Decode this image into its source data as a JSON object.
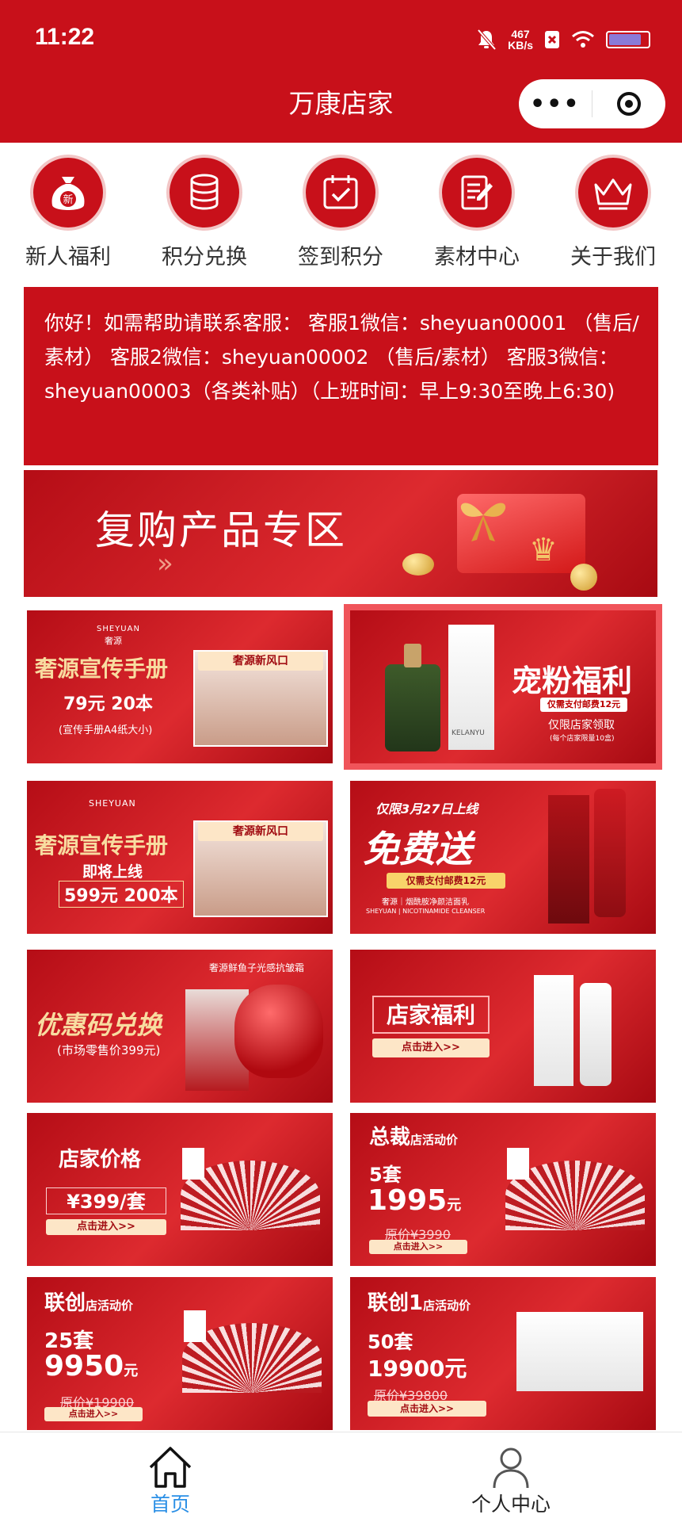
{
  "status_bar": {
    "time": "11:22",
    "net_speed": "467",
    "net_unit": "KB/s"
  },
  "header": {
    "title": "万康店家",
    "more_label": "•••"
  },
  "menu": [
    {
      "label": "新人福利",
      "icon": "money-bag-icon",
      "badge": "新"
    },
    {
      "label": "积分兑换",
      "icon": "coin-stack-icon"
    },
    {
      "label": "签到积分",
      "icon": "calendar-check-icon"
    },
    {
      "label": "素材中心",
      "icon": "document-edit-icon"
    },
    {
      "label": "关于我们",
      "icon": "crown-icon"
    }
  ],
  "notice": {
    "text": "你好！如需帮助请联系客服： 客服1微信：sheyuan00001 （售后/素材） 客服2微信：sheyuan00002 （售后/素材） 客服3微信：sheyuan00003（各类补贴）（上班时间：早上9:30至晚上6:30)"
  },
  "banners": {
    "repurchase": {
      "title": "复购产品专区",
      "arrows": "»"
    },
    "brochure1": {
      "brand": "SHEYUAN",
      "brand_cn": "奢源",
      "title": "奢源宣传手册",
      "price": "79元 20本",
      "note": "(宣传手册A4纸大小)",
      "tag": "奢源新风口"
    },
    "fan_benefit": {
      "title": "宠粉福利",
      "sub1": "仅需支付邮费12元",
      "sub2": "仅限店家领取",
      "sub3": "(每个店家限量10盒)",
      "product_brand": "KELANYU"
    },
    "brochure2": {
      "brand": "SHEYUAN",
      "title": "奢源宣传手册",
      "line1": "即将上线",
      "line2": "599元 200本",
      "tag": "奢源新风口"
    },
    "free_gift": {
      "top": "仅限3月27日上线",
      "title": "免费送",
      "pill": "仅需支付邮费12元",
      "caption": "奢源｜烟酰胺净颜洁面乳",
      "caption_en": "SHEYUAN | NICOTINAMIDE CLEANSER"
    },
    "coupon": {
      "top": "奢源鲜鱼子光感抗皱霜",
      "title": "优惠码兑换",
      "sub": "(市场零售价399元)"
    },
    "store_benefit": {
      "title": "店家福利",
      "button": "点击进入>>"
    },
    "store_price": {
      "title": "店家价格",
      "price": "¥399/套",
      "button": "点击进入>>"
    },
    "president": {
      "title": "总裁",
      "suffix": "店活动价",
      "qty": "5套",
      "price": "1995",
      "unit": "元",
      "orig": "原价¥3990",
      "button": "点击进入>>"
    },
    "co_founder": {
      "title": "联创",
      "suffix": "店活动价",
      "qty": "25套",
      "price": "9950",
      "unit": "元",
      "orig": "原价¥19900",
      "button": "点击进入>>"
    },
    "co_founder1": {
      "title": "联创1",
      "suffix": "店活动价",
      "qty": "50套",
      "price": "19900元",
      "orig": "原价¥39800",
      "button": "点击进入>>"
    }
  },
  "tabbar": [
    {
      "label": "首页",
      "icon": "home-icon",
      "active": true
    },
    {
      "label": "个人中心",
      "icon": "user-icon",
      "active": false
    }
  ],
  "colors": {
    "brand_red": "#c8101a",
    "tab_active": "#2a8fe6",
    "tab_inactive": "#222222"
  }
}
